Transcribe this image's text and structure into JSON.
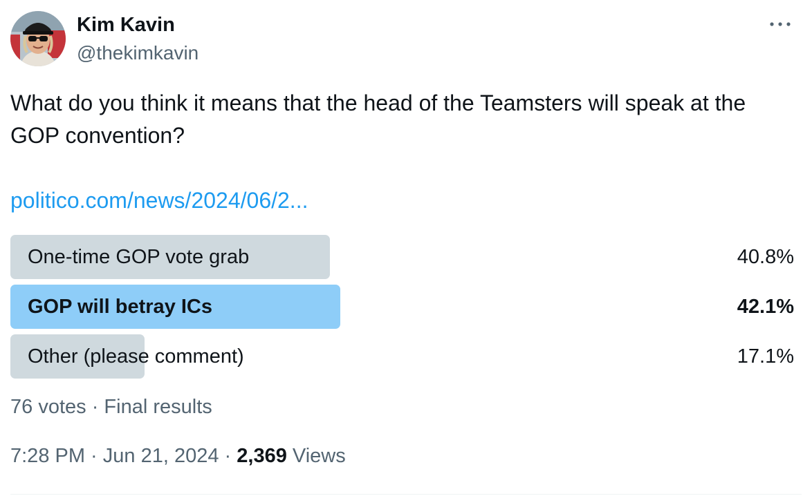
{
  "author": {
    "display_name": "Kim Kavin",
    "handle": "@thekimkavin",
    "avatar_icon": "profile-photo"
  },
  "more_menu_icon": "more-horizontal-icon",
  "tweet": {
    "text": "What do you think it means that the head of the Teamsters will speak at the GOP convention?",
    "link": "politico.com/news/2024/06/2..."
  },
  "poll": {
    "options": [
      {
        "label": "One-time GOP vote grab",
        "percent_text": "40.8%",
        "fraction": 0.408,
        "winner": false
      },
      {
        "label": "GOP will betray ICs",
        "percent_text": "42.1%",
        "fraction": 0.421,
        "winner": true
      },
      {
        "label": "Other (please comment)",
        "percent_text": "17.1%",
        "fraction": 0.171,
        "winner": false
      }
    ],
    "votes": "76 votes",
    "separator": " · ",
    "status": "Final results"
  },
  "meta": {
    "time": "7:28 PM",
    "date": "Jun 21, 2024",
    "separator": " · ",
    "views_count": "2,369",
    "views_label": "Views"
  },
  "colors": {
    "text": "#0f1419",
    "secondary": "#536471",
    "link": "#1d9bf0",
    "poll_bar": "#cfd9de",
    "poll_bar_winner": "#8ecdf8"
  }
}
